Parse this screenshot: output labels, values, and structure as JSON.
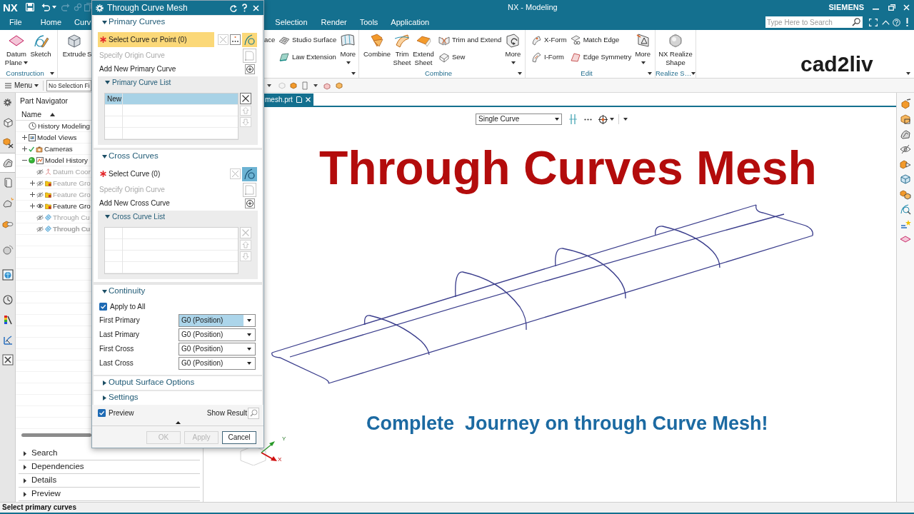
{
  "title_bar": {
    "logo": "NX",
    "title": "NX - Modeling",
    "brand": "SIEMENS"
  },
  "menu_tabs": [
    "File",
    "Home",
    "Curv",
    "Selection",
    "Render",
    "Tools",
    "Application"
  ],
  "search": {
    "placeholder": "Type Here to Search"
  },
  "ribbon": {
    "groups": [
      {
        "label": "Construction",
        "launcher": true,
        "columns": [
          {
            "kind": "large",
            "label": "Datum Plane",
            "dropdown": true
          },
          {
            "kind": "large",
            "label": "Sketch"
          }
        ]
      },
      {
        "columns": [
          {
            "kind": "large",
            "label": "Extrude"
          },
          {
            "kind": "partial_large",
            "label": "S"
          }
        ]
      },
      {
        "launcher": true,
        "columns": [
          {
            "kind": "partial_small",
            "label": "ace"
          },
          {
            "kind": "stack",
            "items": [
              "Studio Surface",
              "Law Extension"
            ]
          },
          {
            "kind": "large",
            "label": "More",
            "dropdown": true
          }
        ]
      },
      {
        "label": "Combine",
        "launcher": true,
        "columns": [
          {
            "kind": "large",
            "label": "Combine"
          },
          {
            "kind": "large",
            "label": "Trim Sheet"
          },
          {
            "kind": "large",
            "label": "Extend Sheet"
          },
          {
            "kind": "stack",
            "items": [
              "Trim and Extend",
              "Sew"
            ]
          },
          {
            "kind": "large",
            "label": "More",
            "dropdown": true
          }
        ]
      },
      {
        "label": "Edit",
        "launcher": true,
        "columns": [
          {
            "kind": "stack",
            "items": [
              "X-Form",
              "I-Form"
            ]
          },
          {
            "kind": "stack",
            "items": [
              "Match Edge",
              "Edge Symmetry"
            ]
          },
          {
            "kind": "large",
            "label": "More",
            "dropdown": true
          }
        ]
      },
      {
        "label": "Realize S…",
        "launcher": true,
        "columns": [
          {
            "kind": "large",
            "label": "NX Realize Shape"
          }
        ]
      }
    ]
  },
  "channel_logo": "cad2liv",
  "toolbar": {
    "menu_label": "Menu",
    "selection_filter": "No Selection Fi"
  },
  "resource_bar": {
    "tabs": [
      {
        "selected": false
      },
      {
        "selected": false
      },
      {
        "selected": true
      },
      {
        "selected": false
      },
      {
        "selected": false
      },
      {
        "selected": false
      },
      {
        "selected": false
      },
      {
        "selected": false
      },
      {
        "selected": false
      },
      {
        "selected": false
      },
      {
        "selected": false
      },
      {
        "selected": false
      }
    ]
  },
  "navigator": {
    "title": "Part Navigator",
    "column": "Name",
    "tree": [
      {
        "kind": "history",
        "label": "History Modeling"
      },
      {
        "kind": "views",
        "label": "Model Views",
        "expanded": false
      },
      {
        "kind": "cameras",
        "label": "Cameras",
        "expanded": false
      },
      {
        "kind": "model_history",
        "label": "Model History",
        "expanded": true,
        "children": [
          {
            "kind": "datum",
            "label": "Datum Coor",
            "visible": false,
            "current": false
          },
          {
            "kind": "feature_group",
            "label": "Feature Gro",
            "expanded": false,
            "visible": false,
            "current": false
          },
          {
            "kind": "feature_group",
            "label": "Feature Gro",
            "expanded": false,
            "visible": false,
            "current": false
          },
          {
            "kind": "feature_group",
            "label": "Feature Gro",
            "expanded": false,
            "visible": true,
            "current": false
          },
          {
            "kind": "through_curve",
            "label": "Through Cu",
            "visible": false,
            "current": false
          },
          {
            "kind": "through_curve",
            "label": "Through Cu",
            "visible": false,
            "current": true
          }
        ]
      }
    ],
    "panels": [
      "Search",
      "Dependencies",
      "Details",
      "Preview"
    ]
  },
  "graphics": {
    "tab": "mesh.prt",
    "selection_filter": "Single Curve",
    "headline": "Through Curves Mesh",
    "subtitle": "Complete  Journey on through Curve Mesh!",
    "triad": {
      "x_label": "X",
      "y_label": "Y"
    }
  },
  "dialog": {
    "title": "Through Curve Mesh",
    "sections": [
      {
        "kind": "curves",
        "title": "Primary Curves",
        "expanded": true,
        "select": {
          "label": "Select Curve or Point (0)",
          "required": true,
          "active": true,
          "point_option": true
        },
        "origin": "Specify Origin Curve",
        "add": "Add New Primary Curve",
        "list": {
          "title": "Primary Curve List",
          "rows": [
            {
              "label": "New",
              "selected": true
            }
          ]
        }
      },
      {
        "kind": "curves",
        "title": "Cross Curves",
        "expanded": true,
        "select": {
          "label": "Select Curve (0)",
          "required": true,
          "active": false
        },
        "origin": "Specify Origin Curve",
        "add": "Add New Cross Curve",
        "list": {
          "title": "Cross Curve List"
        }
      },
      {
        "kind": "continuity",
        "title": "Continuity",
        "expanded": true,
        "apply_to_all": {
          "label": "Apply to All",
          "checked": true
        },
        "rows": [
          {
            "label": "First Primary",
            "value": "G0 (Position)",
            "selected": true
          },
          {
            "label": "Last Primary",
            "value": "G0 (Position)",
            "selected": false
          },
          {
            "label": "First Cross",
            "value": "G0 (Position)",
            "selected": false
          },
          {
            "label": "Last Cross",
            "value": "G0 (Position)",
            "selected": false
          }
        ]
      },
      {
        "kind": "panel",
        "title": "Output Surface Options",
        "expanded": false
      },
      {
        "kind": "panel",
        "title": "Settings",
        "expanded": false
      }
    ],
    "preview": {
      "label": "Preview",
      "checked": true
    },
    "show_result": "Show Result",
    "buttons": [
      {
        "label": "OK",
        "disabled": true
      },
      {
        "label": "Apply",
        "disabled": true
      },
      {
        "label": "Cancel",
        "disabled": false
      }
    ]
  },
  "status_bar": {
    "prompt": "Select primary curves"
  }
}
